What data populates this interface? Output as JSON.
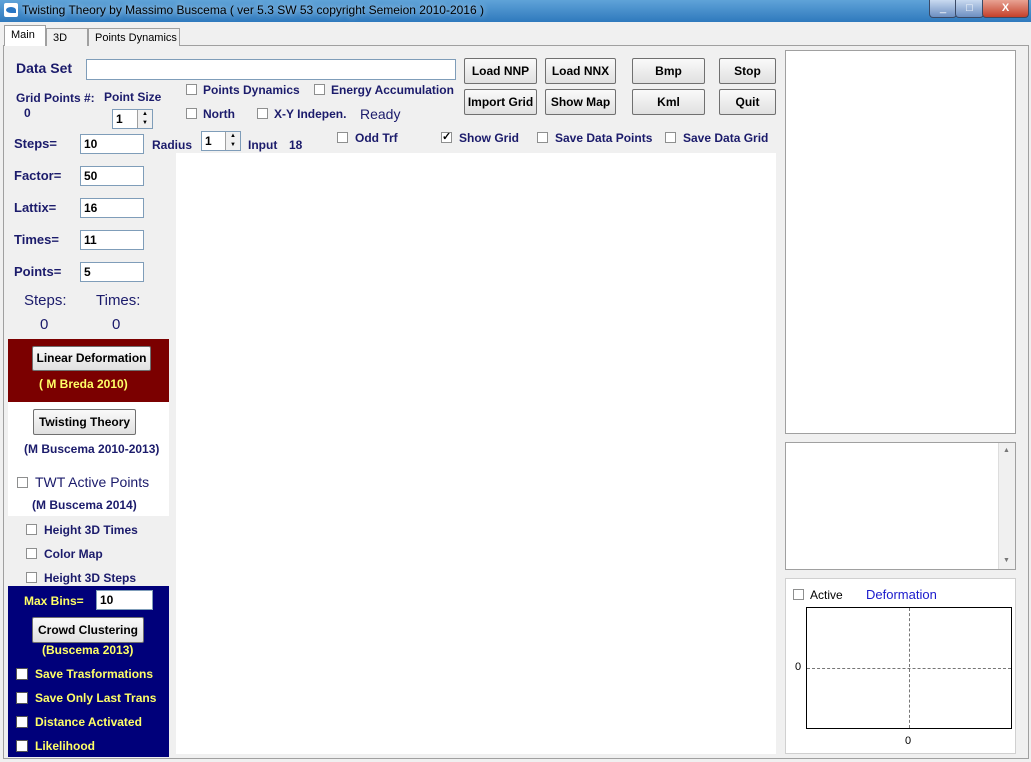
{
  "window": {
    "title": "Twisting Theory by Massimo Buscema ( ver 5.3 SW 53  copyright Semeion 2010-2016 )",
    "controls": [
      "_",
      "□",
      "X"
    ]
  },
  "tabs": [
    "Main",
    "3D",
    "Points Dynamics"
  ],
  "top": {
    "data_set_label": "Data Set",
    "data_set_value": "",
    "grid_points_label": "Grid Points #:",
    "grid_points_value": "0",
    "point_size_label": "Point Size",
    "point_size_value": "1",
    "status": "Ready",
    "radius_label": "Radius",
    "radius_value": "1",
    "input_label": "Input",
    "input_value": "18"
  },
  "checkboxes": {
    "points_dynamics": {
      "label": "Points Dynamics",
      "checked": false
    },
    "energy_accumulation": {
      "label": "Energy Accumulation",
      "checked": false
    },
    "north": {
      "label": "North",
      "checked": false
    },
    "xy_indep": {
      "label": "X-Y Indepen.",
      "checked": false
    },
    "odd_trf": {
      "label": "Odd Trf",
      "checked": false
    },
    "show_grid": {
      "label": "Show Grid",
      "checked": true
    },
    "save_data_points": {
      "label": "Save Data Points",
      "checked": false
    },
    "save_data_grid": {
      "label": "Save Data Grid",
      "checked": false
    }
  },
  "buttons": {
    "load_nnp": "Load NNP",
    "load_nnx": "Load NNX",
    "bmp": "Bmp",
    "stop": "Stop",
    "import_grid": "Import Grid",
    "show_map": "Show Map",
    "kml": "Kml",
    "quit": "Quit"
  },
  "params": [
    {
      "label": "Steps=",
      "value": "10"
    },
    {
      "label": "Factor=",
      "value": "50"
    },
    {
      "label": "Lattix=",
      "value": "16"
    },
    {
      "label": "Times=",
      "value": "11"
    },
    {
      "label": "Points=",
      "value": "5"
    }
  ],
  "counters": {
    "steps_label": "Steps:",
    "steps_value": "0",
    "times_label": "Times:",
    "times_value": "0"
  },
  "linear_deformation": {
    "button": "Linear Deformation",
    "credit": "( M Breda 2010)"
  },
  "twisting_theory": {
    "button": "Twisting Theory",
    "credit": "(M Buscema 2010-2013)"
  },
  "twt": {
    "label": "TWT Active Points",
    "credit": "(M Buscema 2014)"
  },
  "options": [
    {
      "label": "Height 3D Times",
      "checked": false
    },
    {
      "label": "Color Map",
      "checked": false
    },
    {
      "label": "Height 3D Steps",
      "checked": false
    }
  ],
  "crowd": {
    "max_bins_label": "Max Bins=",
    "max_bins_value": "10",
    "button": "Crowd Clustering",
    "credit": "(Buscema 2013)"
  },
  "saves": [
    {
      "label": "Save Trasformations",
      "checked": false
    },
    {
      "label": "Save Only Last Trans",
      "checked": false
    },
    {
      "label": "Distance Activated",
      "checked": false
    },
    {
      "label": "Likelihood",
      "checked": false
    }
  ],
  "deformation_panel": {
    "active_label": "Active",
    "active_checked": false,
    "title": "Deformation",
    "y_axis_tick": "0",
    "x_axis_tick": "0"
  }
}
